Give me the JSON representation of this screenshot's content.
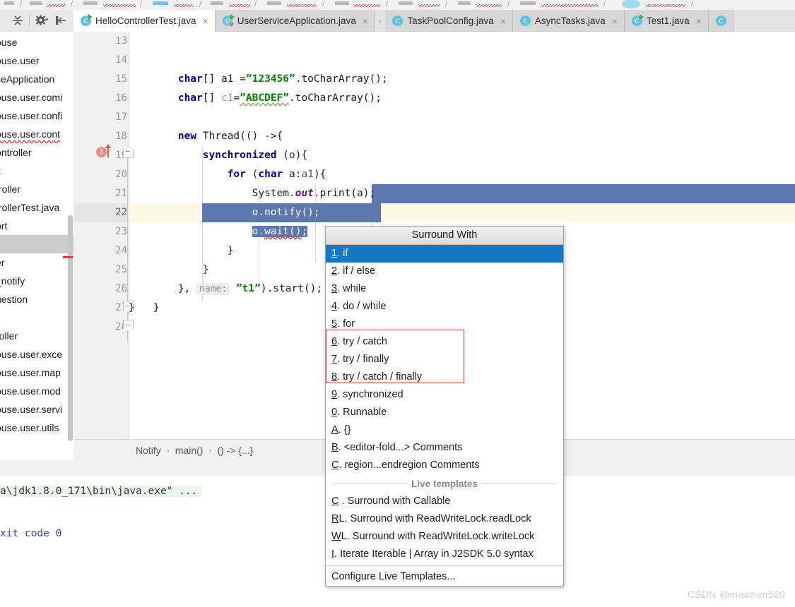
{
  "app": {
    "watermark": "CSDN @mischen520"
  },
  "toolbar": {
    "buttons": [
      {
        "name": "collapse-all-icon",
        "label": "Collapse All"
      },
      {
        "name": "settings-gear-icon",
        "label": "Settings"
      },
      {
        "name": "hide-panel-icon",
        "label": "Hide"
      }
    ]
  },
  "tabs": {
    "items": [
      {
        "label": "HelloControllerTest.java",
        "icon": "java-class-run-icon",
        "active": true,
        "close": "×"
      },
      {
        "label": "UserServiceApplication.java",
        "icon": "java-class-spring-run-icon",
        "active": false,
        "close": "×"
      },
      {
        "label": "TaskPoolConfig.java",
        "icon": "java-class-icon",
        "active": false,
        "close": "×"
      },
      {
        "label": "AsyncTasks.java",
        "icon": "java-class-icon",
        "active": false,
        "close": "×"
      },
      {
        "label": "Test1.java",
        "icon": "java-class-run-icon",
        "active": false,
        "close": "×"
      }
    ],
    "left_arrow": "‹"
  },
  "project_panel": {
    "rows": [
      {
        "text": "ouse",
        "squiggle": false,
        "selected": false
      },
      {
        "text": "ouse.user",
        "squiggle": false,
        "selected": false
      },
      {
        "text": "ceApplication",
        "squiggle": false,
        "selected": false
      },
      {
        "text": "ouse.user.comi",
        "squiggle": false,
        "selected": false
      },
      {
        "text": "ouse.user.confi",
        "squiggle": false,
        "selected": false
      },
      {
        "text": "ouse.user.cont",
        "squiggle": true,
        "selected": false
      },
      {
        "text": "ontroller",
        "squiggle": false,
        "selected": false
      },
      {
        "text": "k",
        "squiggle": false,
        "selected": false
      },
      {
        "text": "troller",
        "squiggle": false,
        "selected": false
      },
      {
        "text": "trollerTest.java",
        "squiggle": false,
        "selected": false
      },
      {
        "text": "ort",
        "squiggle": false,
        "selected": false
      },
      {
        "text": "",
        "squiggle": false,
        "selected": true
      },
      {
        "text": "er",
        "squiggle": false,
        "selected": false
      },
      {
        "text": "_notify",
        "squiggle": false,
        "selected": false
      },
      {
        "text": "uestion",
        "squiggle": false,
        "selected": false
      },
      {
        "text": "",
        "squiggle": false,
        "selected": false
      },
      {
        "text": "roller",
        "squiggle": false,
        "selected": false
      },
      {
        "text": "ouse.user.exce",
        "squiggle": false,
        "selected": false
      },
      {
        "text": "ouse.user.map",
        "squiggle": false,
        "selected": false
      },
      {
        "text": "ouse.user.mod",
        "squiggle": false,
        "selected": false
      },
      {
        "text": "ouse.user.servi",
        "squiggle": false,
        "selected": false
      },
      {
        "text": "ouse.user.utils",
        "squiggle": false,
        "selected": false
      }
    ]
  },
  "editor": {
    "first_line": 13,
    "current_line": 22,
    "line_numbers": [
      13,
      14,
      15,
      16,
      17,
      18,
      19,
      20,
      21,
      22,
      23,
      24,
      25,
      26,
      27,
      28
    ],
    "gutter_lambda_marker": "λ",
    "code_lines": [
      {
        "n": 13,
        "text": ""
      },
      {
        "n": 14,
        "text": "        char[] a1 =\"123456\".toCharArray();"
      },
      {
        "n": 15,
        "text": "        char[] c1=\"ABCDEF\".toCharArray();"
      },
      {
        "n": 16,
        "text": ""
      },
      {
        "n": 17,
        "text": "        new Thread(() ->{"
      },
      {
        "n": 18,
        "text": "            synchronized (o){"
      },
      {
        "n": 19,
        "text": "                for (char a:a1){"
      },
      {
        "n": 20,
        "text": "                    System.out.print(a);"
      },
      {
        "n": 21,
        "text": "                    o.notify();"
      },
      {
        "n": 22,
        "text": "                    o.wait();"
      },
      {
        "n": 23,
        "text": "                }"
      },
      {
        "n": 24,
        "text": "            }"
      },
      {
        "n": 25,
        "text": "        }, name: \"t1\").start();"
      },
      {
        "n": 26,
        "text": "    }"
      },
      {
        "n": 27,
        "text": "}"
      },
      {
        "n": 28,
        "text": ""
      }
    ],
    "tokens": {
      "char": "char",
      "new": "new",
      "synchronized": "synchronized",
      "for": "for",
      "str_123456": "\"123456\"",
      "str_ABCDEF": "\"ABCDEF\"",
      "str_t1": "\"t1\"",
      "param_hint_name": "name:",
      "field_out": "out"
    },
    "breadcrumbs": [
      "Notify",
      "main()",
      "() -> {...}"
    ],
    "breadcrumb_separator": "›"
  },
  "popup": {
    "title": "Surround With",
    "items": [
      {
        "mnemonic": "1",
        "label": ". if",
        "selected": true
      },
      {
        "mnemonic": "2",
        "label": ". if / else",
        "selected": false
      },
      {
        "mnemonic": "3",
        "label": ". while",
        "selected": false
      },
      {
        "mnemonic": "4",
        "label": ". do / while",
        "selected": false
      },
      {
        "mnemonic": "5",
        "label": ". for",
        "selected": false
      },
      {
        "mnemonic": "6",
        "label": ". try / catch",
        "selected": false
      },
      {
        "mnemonic": "7",
        "label": ". try / finally",
        "selected": false
      },
      {
        "mnemonic": "8",
        "label": ". try / catch / finally",
        "selected": false
      },
      {
        "mnemonic": "9",
        "label": ". synchronized",
        "selected": false
      },
      {
        "mnemonic": "0",
        "label": ". Runnable",
        "selected": false
      },
      {
        "mnemonic": "A",
        "label": ". {}",
        "selected": false
      },
      {
        "mnemonic": "B",
        "label": ". <editor-fold...> Comments",
        "selected": false
      },
      {
        "mnemonic": "C",
        "label": ". region...endregion Comments",
        "selected": false
      }
    ],
    "live_templates_header": "Live templates",
    "live_templates": [
      {
        "mnemonic": "C",
        "label": " . Surround with Callable"
      },
      {
        "mnemonic": "R",
        "label": "L. Surround with ReadWriteLock.readLock"
      },
      {
        "mnemonic": "W",
        "label": "L. Surround with ReadWriteLock.writeLock"
      },
      {
        "mnemonic": "I",
        "label": ". Iterate Iterable | Array in J2SDK 5.0 syntax"
      }
    ],
    "configure_label": "Configure Live Templates...",
    "highlight_color": "#1377c5",
    "annotation_box_color": "#d93025"
  },
  "console": {
    "lines": [
      {
        "text": "a\\jdk1.8.0_171\\bin\\java.exe\" ...",
        "kind": "cmd"
      },
      {
        "text": "xit code 0",
        "kind": "out"
      }
    ]
  }
}
